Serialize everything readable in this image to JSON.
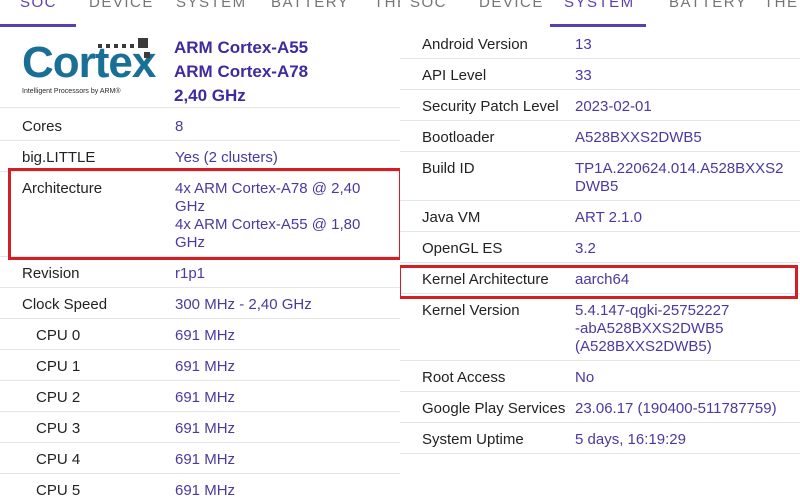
{
  "left": {
    "tabs": [
      "SOC",
      "DEVICE",
      "SYSTEM",
      "BATTERY",
      "THE"
    ],
    "active_tab": "SOC",
    "logo": {
      "brand": "Cortex",
      "tagline": "Intelligent Processors by ARM®"
    },
    "soc_lines": [
      "ARM Cortex-A55",
      "ARM Cortex-A78",
      "2,40 GHz"
    ],
    "rows": [
      {
        "label": "Cores",
        "value": [
          "8"
        ]
      },
      {
        "label": "big.LITTLE",
        "value": [
          "Yes (2 clusters)"
        ]
      },
      {
        "label": "Architecture",
        "value": [
          "4x ARM Cortex-A78 @ 2,40",
          "GHz",
          "4x ARM Cortex-A55 @ 1,80",
          "GHz"
        ]
      },
      {
        "label": "Revision",
        "value": [
          "r1p1"
        ]
      },
      {
        "label": "Clock Speed",
        "value": [
          "300 MHz - 2,40 GHz"
        ]
      },
      {
        "label": "CPU 0",
        "value": [
          "691 MHz"
        ]
      },
      {
        "label": "CPU 1",
        "value": [
          "691 MHz"
        ]
      },
      {
        "label": "CPU 2",
        "value": [
          "691 MHz"
        ]
      },
      {
        "label": "CPU 3",
        "value": [
          "691 MHz"
        ]
      },
      {
        "label": "CPU 4",
        "value": [
          "691 MHz"
        ]
      },
      {
        "label": "CPU 5",
        "value": [
          "691 MHz"
        ]
      }
    ]
  },
  "right": {
    "tabs": [
      "SOC",
      "DEVICE",
      "SYSTEM",
      "BATTERY",
      "THE"
    ],
    "active_tab": "SYSTEM",
    "rows": [
      {
        "label": "Android Version",
        "value": [
          "13"
        ]
      },
      {
        "label": "API Level",
        "value": [
          "33"
        ]
      },
      {
        "label": "Security Patch Level",
        "value": [
          "2023-02-01"
        ]
      },
      {
        "label": "Bootloader",
        "value": [
          "A528BXXS2DWB5"
        ]
      },
      {
        "label": "Build ID",
        "value": [
          "TP1A.220624.014.A528BXXS2",
          "DWB5"
        ]
      },
      {
        "label": "Java VM",
        "value": [
          "ART 2.1.0"
        ]
      },
      {
        "label": "OpenGL ES",
        "value": [
          "3.2"
        ]
      },
      {
        "label": "Kernel Architecture",
        "value": [
          "aarch64"
        ]
      },
      {
        "label": "Kernel Version",
        "value": [
          "5.4.147-qgki-25752227",
          "-abA528BXXS2DWB5",
          "(A528BXXS2DWB5)"
        ]
      },
      {
        "label": "Root Access",
        "value": [
          "No"
        ]
      },
      {
        "label": "Google Play Services",
        "value": [
          "23.06.17 (190400-511787759)"
        ]
      },
      {
        "label": "System Uptime",
        "value": [
          "5 days, 16:19:29"
        ]
      }
    ]
  },
  "highlight_color": "#d21f26",
  "accent_color": "#5b3fb0",
  "value_color": "#4a3a9e"
}
